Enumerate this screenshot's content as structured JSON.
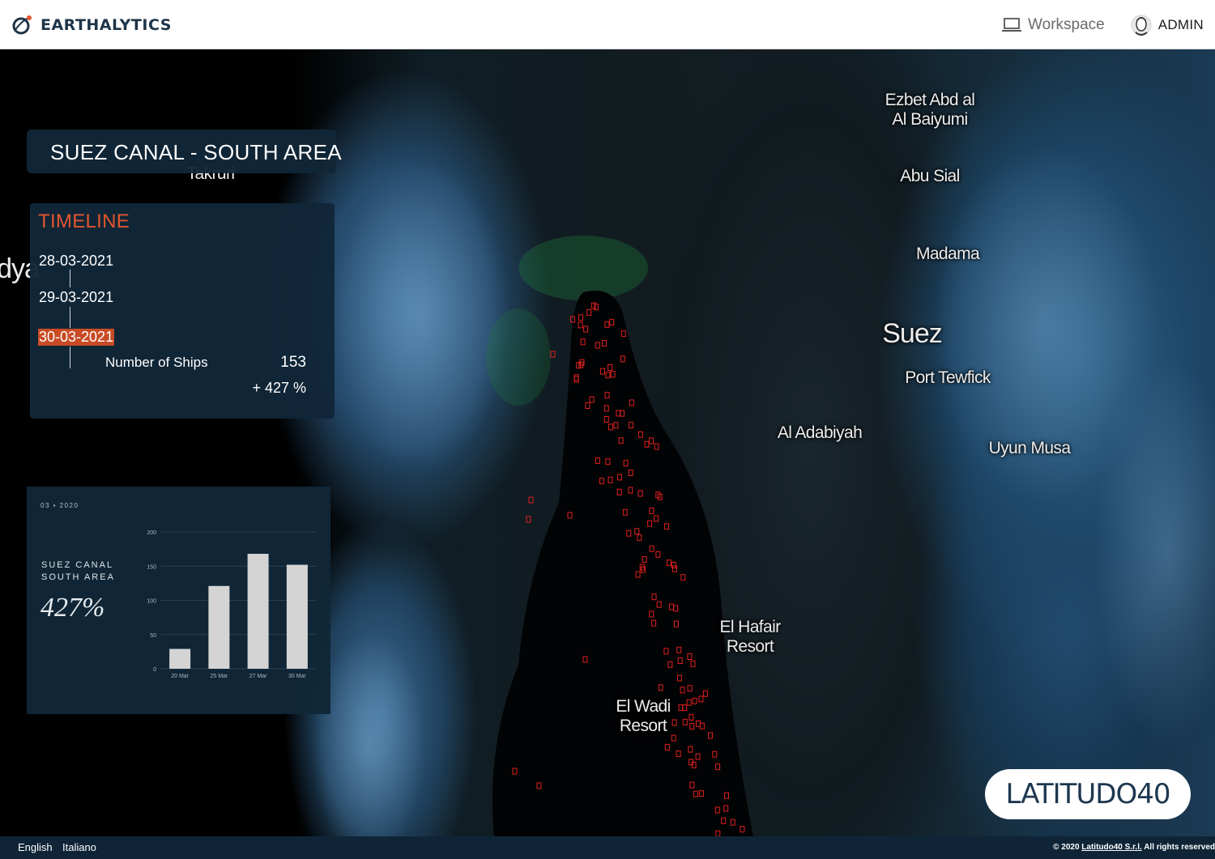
{
  "header": {
    "brand": "EARTHALYTICS",
    "workspace_label": "Workspace",
    "admin_label": "ADMIN"
  },
  "colors": {
    "brand_dark": "#1e3448",
    "brand_accent": "#e2562f",
    "panel_bg": "#112738",
    "ship_marker": "#e02020"
  },
  "icons": {
    "brand_logo": "orbit-logo-icon",
    "workspace": "laptop-icon",
    "admin": "user-avatar-icon"
  },
  "map": {
    "labels": [
      {
        "name": "ezbet",
        "text": "Ezbet Abd al\nAl Baiyumi"
      },
      {
        "name": "abu-sial",
        "text": "Abu Sial"
      },
      {
        "name": "madama",
        "text": "Madama"
      },
      {
        "name": "suez",
        "text": "Suez"
      },
      {
        "name": "port-tewfick",
        "text": "Port Tewfick"
      },
      {
        "name": "al-adabiyah",
        "text": "Al Adabiyah"
      },
      {
        "name": "uyun-musa",
        "text": "Uyun Musa"
      },
      {
        "name": "el-hafair",
        "text": "El Hafair\nResort"
      },
      {
        "name": "el-wadi",
        "text": "El Wadi\nResort"
      },
      {
        "name": "takruri",
        "text": "Takruri"
      },
      {
        "name": "dyan",
        "text": "dya"
      }
    ]
  },
  "area_title": "SUEZ CANAL - SOUTH AREA",
  "timeline": {
    "heading": "TIMELINE",
    "dates": [
      "28-03-2021",
      "29-03-2021",
      "30-03-2021"
    ],
    "active_index": 2,
    "stat_label": "Number of Ships",
    "stat_value": "153",
    "stat_change": "+ 427 %"
  },
  "chart_panel": {
    "date_label": "03 • 2020",
    "area_label_line1": "SUEZ CANAL",
    "area_label_line2": "SOUTH AREA",
    "percent": "427%"
  },
  "chart_data": {
    "type": "bar",
    "categories": [
      "20 Mar",
      "25 Mar",
      "27 Mar",
      "30 Mar"
    ],
    "values": [
      29,
      121,
      168,
      152
    ],
    "ylim": [
      0,
      200
    ],
    "yticks": [
      0,
      50,
      100,
      150,
      200
    ],
    "bar_color": "#d4d4d4",
    "grid": true
  },
  "badge": {
    "text": "LATITUDO40"
  },
  "footer": {
    "lang_en": "English",
    "lang_it": "Italiano",
    "copyright_prefix": "© 2020",
    "copyright_link": "Latitudo40 S.r.l.",
    "copyright_suffix": "All rights reserved"
  }
}
